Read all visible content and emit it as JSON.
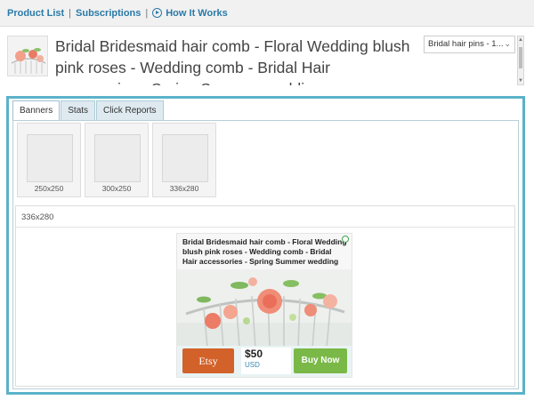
{
  "nav": {
    "product_list": "Product List",
    "separator1": "|",
    "subscriptions": "Subscriptions",
    "separator2": "|",
    "how_it_works": "How It Works"
  },
  "product": {
    "title": "Bridal Bridesmaid hair comb - Floral Wedding blush pink roses - Wedding comb - Bridal Hair accessories - Spring Summer wedding",
    "selected_product": "Bridal hair pins - 1..."
  },
  "tabs": [
    {
      "label": "Banners",
      "active": true
    },
    {
      "label": "Stats",
      "active": false
    },
    {
      "label": "Click Reports",
      "active": false
    }
  ],
  "banner_sizes": [
    "250x250",
    "300x250",
    "336x280"
  ],
  "preview": {
    "size_label": "336x280",
    "ad_title": "Bridal Bridesmaid hair comb - Floral Wedding blush pink roses - Wedding comb - Bridal Hair accessories - Spring Summer wedding",
    "shop_label": "Etsy",
    "price": "$50",
    "currency": "USD",
    "buy_label": "Buy Now"
  },
  "colors": {
    "link": "#2a7aa8",
    "panel_border": "#5bb2c9",
    "etsy_orange": "#d2622a",
    "buy_green": "#7ab847"
  },
  "icons": {
    "how_it_works": "play-circle-icon",
    "ad_badge": "green-circle-badge-icon"
  }
}
